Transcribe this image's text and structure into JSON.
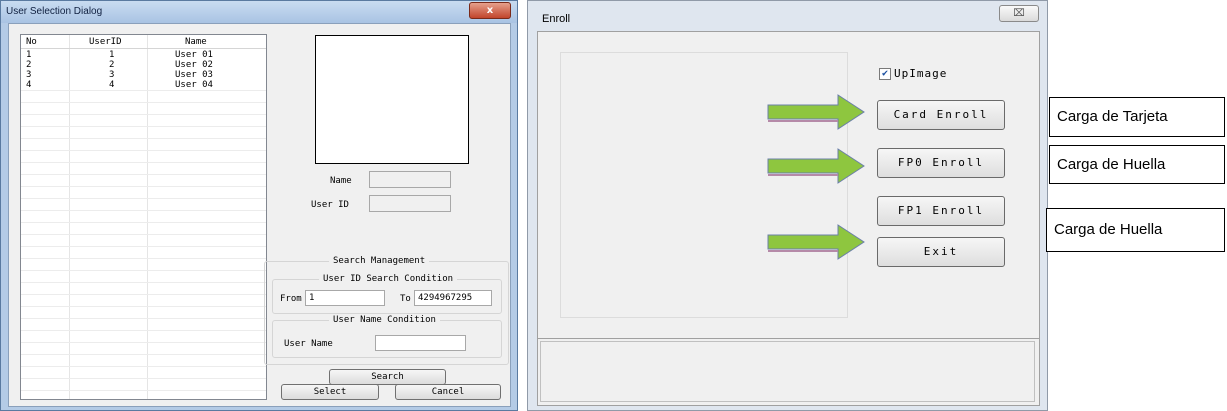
{
  "user_dialog": {
    "title": "User Selection Dialog",
    "close_glyph": "x",
    "columns": [
      "No",
      "UserID",
      "Name"
    ],
    "rows": [
      {
        "no": "1",
        "user_id": "1",
        "name": "User 01"
      },
      {
        "no": "2",
        "user_id": "2",
        "name": "User 02"
      },
      {
        "no": "3",
        "user_id": "3",
        "name": "User 03"
      },
      {
        "no": "4",
        "user_id": "4",
        "name": "User 04"
      }
    ],
    "name_label": "Name",
    "name_value": "",
    "user_id_label": "User ID",
    "user_id_value": "",
    "search_management_title": "Search Management",
    "id_condition_title": "User ID Search Condition",
    "from_label": "From",
    "from_value": "1",
    "to_label": "To",
    "to_value": "4294967295",
    "name_condition_title": "User Name Condition",
    "user_name_label": "User Name",
    "user_name_value": "",
    "search_button": "Search",
    "select_button": "Select",
    "cancel_button": "Cancel"
  },
  "enroll_dialog": {
    "title": "Enroll",
    "close_glyph": "⌧",
    "upimage_label": "UpImage",
    "upimage_checked": true,
    "card_enroll_button": "Card Enroll",
    "fp0_enroll_button": "FP0 Enroll",
    "fp1_enroll_button": "FP1 Enroll",
    "exit_button": "Exit"
  },
  "callouts": {
    "card": "Carga de Tarjeta",
    "fp0": "Carga de Huella",
    "fp1": "Carga de Huella"
  },
  "colors": {
    "arrow_green": "#8ec63f",
    "left_frame": "#b4cbe6"
  }
}
